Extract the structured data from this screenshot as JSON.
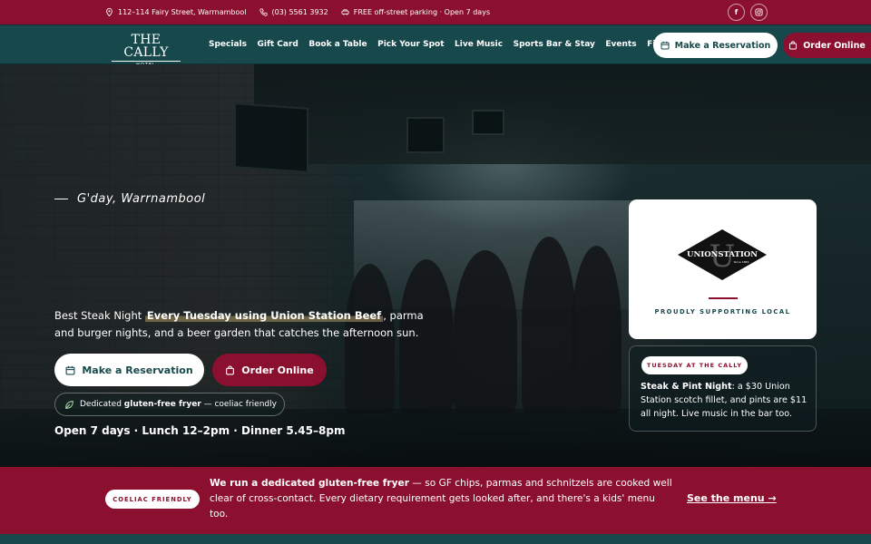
{
  "topbar": {
    "address": "112–114 Fairy Street, Warrnambool",
    "phone": "(03) 5561 3932",
    "parking": "FREE off-street parking · Open 7 days",
    "socials": [
      {
        "icon": "facebook-icon",
        "label": "f"
      },
      {
        "icon": "instagram-icon"
      }
    ]
  },
  "nav": {
    "logo_main": "THE CALLY",
    "logo_sub": "HOTEL",
    "links": [
      "Specials",
      "Gift Card",
      "Book a Table",
      "Pick Your Spot",
      "Live Music",
      "Sports Bar & Stay",
      "Events",
      "Find Us"
    ],
    "reserve_label": "Make a Reservation",
    "order_label": "Order Online"
  },
  "hero": {
    "greeting": "G'day, Warrnambool",
    "intro_pre": "Best Steak Night ",
    "intro_highlight": "Every Tuesday using Union Station Beef",
    "intro_post": ", parma and burger nights, and a beer garden that catches the afternoon sun.",
    "reserve_label": "Make a Reservation",
    "order_label": "Order Online",
    "gf_pre": "Dedicated ",
    "gf_bold": "gluten-free fryer",
    "gf_post": " — coeliac friendly",
    "hours": "Open 7 days · Lunch 12–2pm · Dinner 5.45–8pm"
  },
  "union_station": {
    "logo_text": "UNIONSTATION",
    "logo_letter": "U",
    "logo_since": "Since 1869",
    "tagline": "PROUDLY SUPPORTING LOCAL"
  },
  "tuesday": {
    "badge": "TUESDAY AT THE CALLY",
    "title": "Steak & Pint Night",
    "text": ": a $30 Union Station scotch fillet, and pints are $11 all night. Live music in the bar too."
  },
  "banner": {
    "badge": "COELIAC FRIENDLY",
    "bold": "We run a dedicated gluten-free fryer",
    "text": " — so GF chips, parmas and schnitzels are cooked well clear of cross-contact. Every dietary requirement gets looked after, and there's a kids' menu too.",
    "link": "See the menu →"
  },
  "colors": {
    "brand_red": "#8b0f2e",
    "brand_teal": "#17484b"
  }
}
